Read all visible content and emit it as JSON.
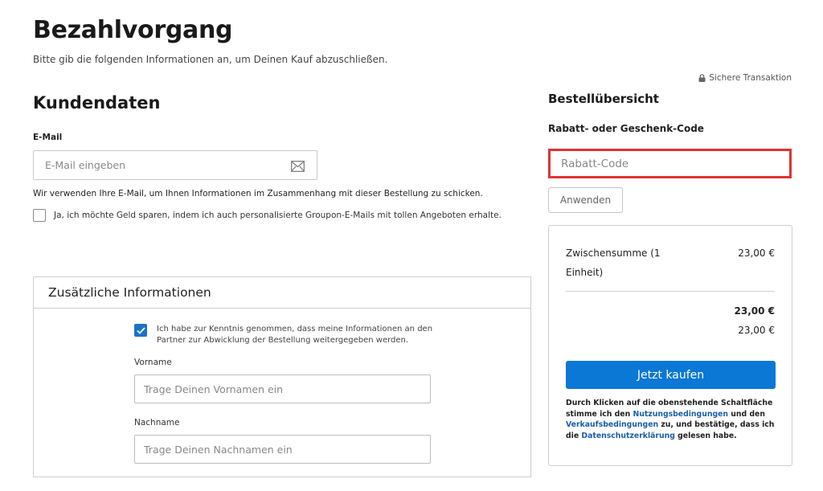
{
  "header": {
    "title": "Bezahlvorgang",
    "subtitle": "Bitte gib die folgenden Informationen an, um Deinen Kauf abzuschließen.",
    "secure_label": "Sichere Transaktion"
  },
  "customer": {
    "section_title": "Kundendaten",
    "email_label": "E-Mail",
    "email_placeholder": "E-Mail eingeben",
    "email_value": "",
    "email_note": "Wir verwenden Ihre E-Mail, um Ihnen Informationen im Zusammenhang mit dieser Bestellung zu schicken.",
    "newsletter_label": "Ja, ich möchte Geld sparen, indem ich auch personalisierte Groupon-E-Mails mit tollen Angeboten erhalte.",
    "newsletter_checked": false
  },
  "additional": {
    "title": "Zusätzliche Informationen",
    "consent_text": "Ich habe zur Kenntnis genommen, dass meine Informationen an den Partner zur Abwicklung der Bestellung weitergegeben werden.",
    "consent_checked": true,
    "first_name_label": "Vorname",
    "first_name_placeholder": "Trage Deinen Vornamen ein",
    "last_name_label": "Nachname",
    "last_name_placeholder": "Trage Deinen Nachnamen ein"
  },
  "order": {
    "title": "Bestellübersicht",
    "coupon_label": "Rabatt- oder Geschenk-Code",
    "coupon_placeholder": "Rabatt-Code",
    "apply_label": "Anwenden",
    "subtotal_label": "Zwischensumme (1 Einheit)",
    "subtotal_value": "23,00 €",
    "total_value": "23,00 €",
    "total_value_2": "23,00 €",
    "buy_label": "Jetzt kaufen",
    "terms": {
      "part1": "Durch Klicken auf die obenstehende Schaltfläche stimme ich den ",
      "link1": "Nutzungsbedingungen",
      "part2": " und den ",
      "link2": "Verkaufsbedingungen",
      "part3": " zu, und bestätige, dass ich die ",
      "link3": "Datenschutzerklärung",
      "part4": " gelesen habe."
    }
  },
  "colors": {
    "accent": "#0b78d6",
    "highlight": "#e03232",
    "checkbox": "#1a73c8"
  },
  "icons": {
    "lock": "lock-icon",
    "mail": "mail-icon",
    "check": "checkmark-icon"
  }
}
